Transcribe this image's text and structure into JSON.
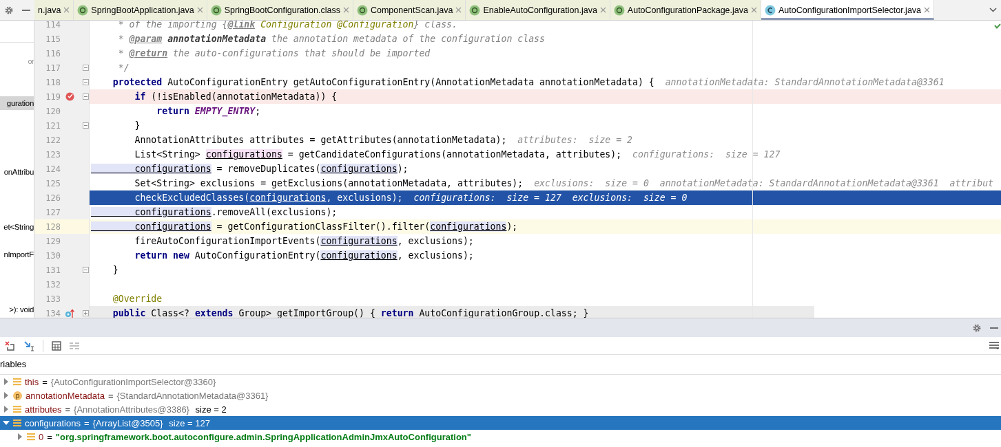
{
  "tabs": [
    {
      "label": "n.java",
      "selected": false
    },
    {
      "label": "SpringBootApplication.java",
      "kind": "annotation",
      "selected": false
    },
    {
      "label": "SpringBootConfiguration.class",
      "kind": "annotation",
      "selected": false
    },
    {
      "label": "ComponentScan.java",
      "kind": "annotation",
      "selected": false
    },
    {
      "label": "EnableAutoConfiguration.java",
      "kind": "annotation",
      "selected": false
    },
    {
      "label": "AutoConfigurationPackage.java",
      "kind": "annotation",
      "selected": false
    },
    {
      "label": "AutoConfigurationImportSelector.java",
      "kind": "class",
      "selected": true
    }
  ],
  "structure": [
    {
      "label": "or",
      "kind": "faint",
      "selected": false
    },
    {
      "label": "guration",
      "selected": true
    },
    {
      "label": "onAttribu",
      "selected": false
    },
    {
      "label": "et<String",
      "selected": false
    },
    {
      "label": "nImportF",
      "selected": false
    },
    {
      "label": ">): void",
      "selected": false
    }
  ],
  "lines": [
    {
      "number": "114",
      "tokens": [
        {
          "text": "     * of the importing {",
          "kind": "doc"
        },
        {
          "text": "@link",
          "kind": "doc-tag"
        },
        {
          "text": " Configuration @Configuration",
          "kind": "doc-ref"
        },
        {
          "text": "} class.",
          "kind": "doc"
        }
      ]
    },
    {
      "number": "115",
      "tokens": [
        {
          "text": "     * ",
          "kind": "doc"
        },
        {
          "text": "@param",
          "kind": "doc-tag"
        },
        {
          "text": " annotationMetadata",
          "kind": "doc-param"
        },
        {
          "text": " the annotation metadata of the configuration class",
          "kind": "doc"
        }
      ]
    },
    {
      "number": "116",
      "tokens": [
        {
          "text": "     * ",
          "kind": "doc"
        },
        {
          "text": "@return",
          "kind": "doc-tag"
        },
        {
          "text": " the auto-configurations that should be imported",
          "kind": "doc"
        }
      ]
    },
    {
      "number": "117",
      "foldable": true,
      "tokens": [
        {
          "text": "     */",
          "kind": "doc"
        }
      ]
    },
    {
      "number": "118",
      "foldable": true,
      "tokens": [
        {
          "text": "    protected",
          "kind": "keyword"
        },
        {
          "text": " AutoConfigurationEntry getAutoConfigurationEntry(AnnotationMetadata annotationMetadata) {",
          "kind": "plain"
        }
      ],
      "hint": "annotationMetadata: StandardAnnotationMetadata@3361"
    },
    {
      "number": "119",
      "breakpoint": true,
      "foldable": true,
      "tokens": [
        {
          "text": "        if",
          "kind": "keyword"
        },
        {
          "text": " (!isEnabled(annotationMetadata)) {",
          "kind": "plain"
        }
      ]
    },
    {
      "number": "120",
      "tokens": [
        {
          "text": "            return",
          "kind": "keyword"
        },
        {
          "text": " EMPTY_ENTRY",
          "kind": "constant"
        },
        {
          "text": ";",
          "kind": "plain"
        }
      ]
    },
    {
      "number": "121",
      "foldable": true,
      "tokens": [
        {
          "text": "        }",
          "kind": "plain"
        }
      ]
    },
    {
      "number": "122",
      "tokens": [
        {
          "text": "        AnnotationAttributes attributes = getAttributes(annotationMetadata);",
          "kind": "plain"
        }
      ],
      "hint": "attributes:  size = 2"
    },
    {
      "number": "123",
      "tokens": [
        {
          "text": "        List<String> ",
          "kind": "plain"
        },
        {
          "text": "configurations",
          "kind": "var-write"
        },
        {
          "text": " = getCandidateConfigurations(annotationMetadata, attributes);",
          "kind": "plain"
        }
      ],
      "hint": "configurations:  size = 127"
    },
    {
      "number": "124",
      "tokens": [
        {
          "text": "        configurations",
          "kind": "var-read"
        },
        {
          "text": " = removeDuplicates(",
          "kind": "plain"
        },
        {
          "text": "configurations",
          "kind": "var-read"
        },
        {
          "text": ");",
          "kind": "plain"
        }
      ]
    },
    {
      "number": "125",
      "tokens": [
        {
          "text": "        Set<String> exclusions = getExclusions(annotationMetadata, attributes);",
          "kind": "plain"
        }
      ],
      "hint": "exclusions:  size = 0  annotationMetadata: StandardAnnotationMetadata@3361  attribut"
    },
    {
      "number": "126",
      "execution_point": true,
      "tokens": [
        {
          "text": "        checkExcludedClasses(",
          "kind": "plain"
        },
        {
          "text": "configurations",
          "kind": "var-read"
        },
        {
          "text": ", exclusions);",
          "kind": "plain"
        }
      ],
      "hint": "configurations:  size = 127  exclusions:  size = 0"
    },
    {
      "number": "127",
      "tokens": [
        {
          "text": "        configurations",
          "kind": "var-read"
        },
        {
          "text": ".removeAll(exclusions);",
          "kind": "plain"
        }
      ]
    },
    {
      "number": "128",
      "caret": true,
      "tokens": [
        {
          "text": "        configurations",
          "kind": "var-read"
        },
        {
          "text": " = getConfigurationClassFilter().filter(",
          "kind": "plain"
        },
        {
          "text": "configurations",
          "kind": "var-read"
        },
        {
          "text": ");",
          "kind": "plain"
        }
      ]
    },
    {
      "number": "129",
      "tokens": [
        {
          "text": "        fireAutoConfigurationImportEvents(",
          "kind": "plain"
        },
        {
          "text": "configurations",
          "kind": "var-read"
        },
        {
          "text": ", exclusions);",
          "kind": "plain"
        }
      ]
    },
    {
      "number": "130",
      "tokens": [
        {
          "text": "        return",
          "kind": "keyword"
        },
        {
          "text": " new",
          "kind": "keyword"
        },
        {
          "text": " AutoConfigurationEntry(",
          "kind": "plain"
        },
        {
          "text": "configurations",
          "kind": "var-read"
        },
        {
          "text": ", exclusions);",
          "kind": "plain"
        }
      ]
    },
    {
      "number": "131",
      "foldable": true,
      "tokens": [
        {
          "text": "    }",
          "kind": "plain"
        }
      ]
    },
    {
      "number": "132"
    },
    {
      "number": "133",
      "tokens": [
        {
          "text": "    @Override",
          "kind": "annotation"
        }
      ]
    },
    {
      "number": "134",
      "overrides": true,
      "foldable": true,
      "collapsed": true,
      "tokens": [
        {
          "text": "    public",
          "kind": "keyword"
        },
        {
          "text": " Class<? ",
          "kind": "plain"
        },
        {
          "text": "extends",
          "kind": "keyword"
        },
        {
          "text": " Group> getImportGroup() { ",
          "kind": "plain"
        },
        {
          "text": "return",
          "kind": "keyword"
        },
        {
          "text": " AutoConfigurationGroup.class; }",
          "kind": "plain"
        }
      ]
    }
  ],
  "debugger": {
    "pane_label": "riables",
    "variables": [
      {
        "name": "this",
        "operator": "=",
        "value": "{AutoConfigurationImportSelector@3360}",
        "kind": "object",
        "expanded": false,
        "selected": false
      },
      {
        "name": "annotationMetadata",
        "operator": "=",
        "value": "{StandardAnnotationMetadata@3361}",
        "kind": "parameter",
        "badge": "p",
        "expanded": false,
        "selected": false
      },
      {
        "name": "attributes",
        "operator": "=",
        "value": "{AnnotationAttributes@3386}",
        "extra": "size = 2",
        "kind": "object",
        "expanded": false,
        "selected": false
      },
      {
        "name": "configurations",
        "operator": "=",
        "value": "{ArrayList@3505}",
        "extra": "size = 127",
        "kind": "object",
        "expanded": true,
        "selected": true,
        "children": [
          {
            "name": "0",
            "operator": "=",
            "value": "\"org.springframework.boot.autoconfigure.admin.SpringApplicationAdminJmxAutoConfiguration\"",
            "kind": "string",
            "expanded": false,
            "selected": false
          }
        ]
      }
    ]
  }
}
